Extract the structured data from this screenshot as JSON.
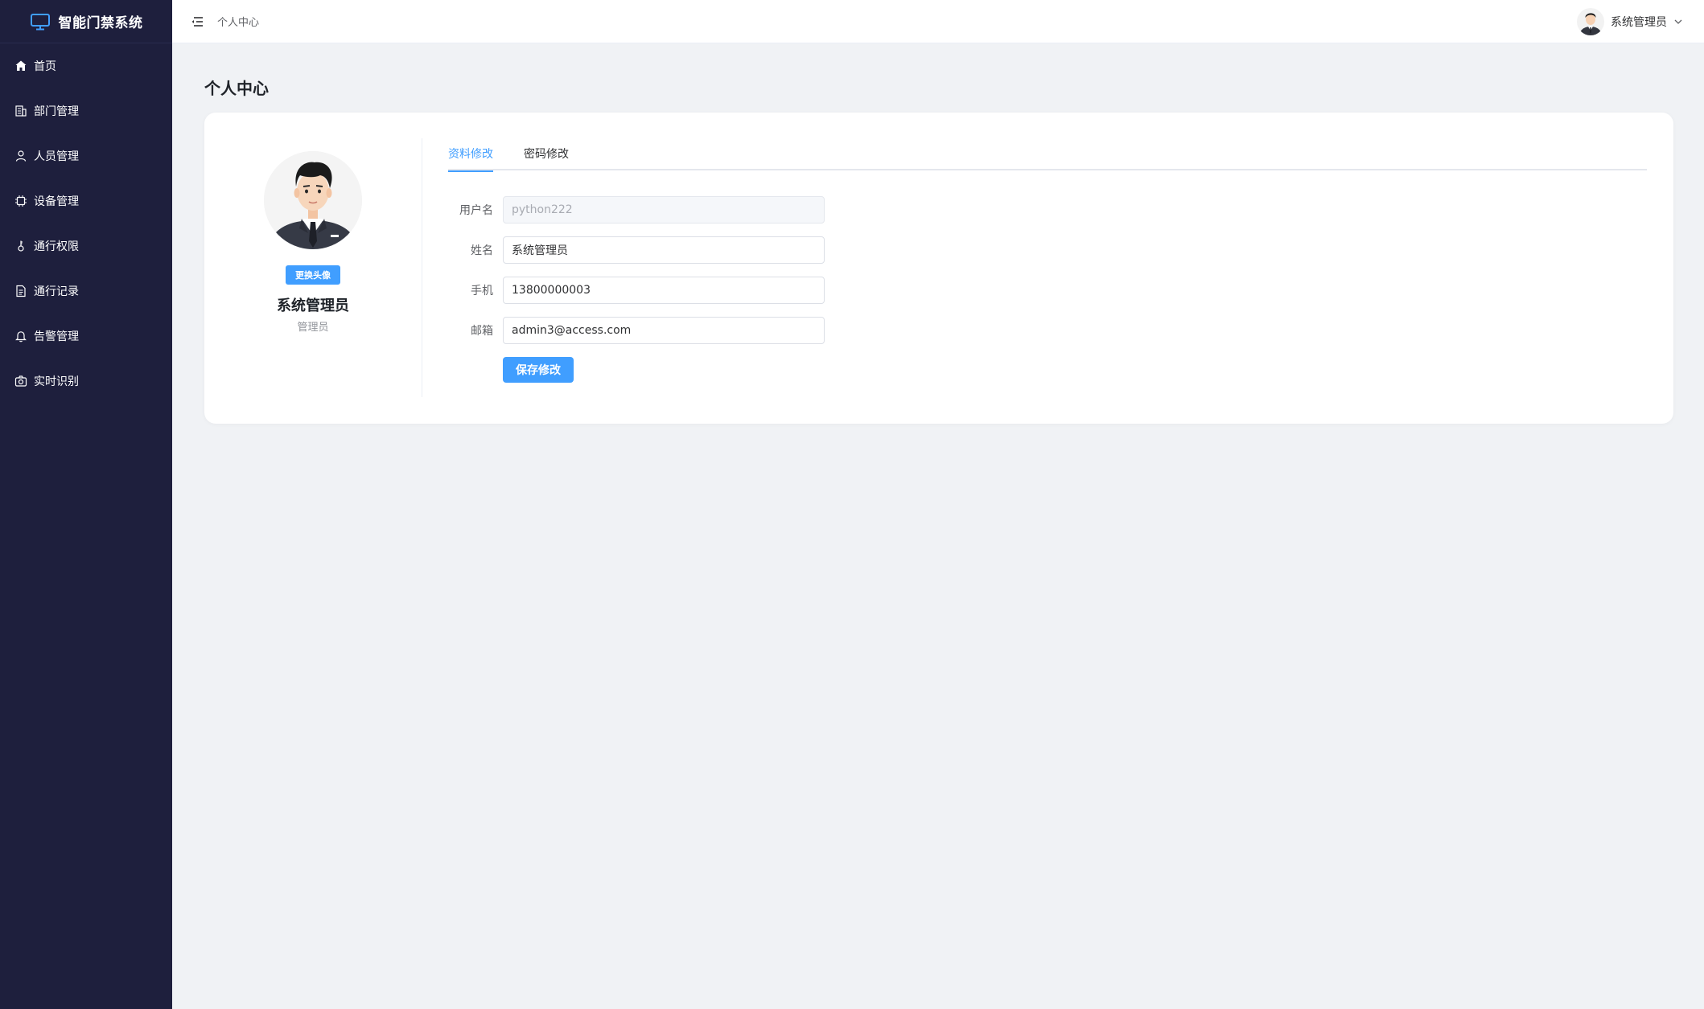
{
  "app": {
    "title": "智能门禁系统"
  },
  "sidebar": {
    "items": [
      {
        "label": "首页",
        "icon": "home-icon"
      },
      {
        "label": "部门管理",
        "icon": "building-icon"
      },
      {
        "label": "人员管理",
        "icon": "user-icon"
      },
      {
        "label": "设备管理",
        "icon": "chip-icon"
      },
      {
        "label": "通行权限",
        "icon": "key-icon"
      },
      {
        "label": "通行记录",
        "icon": "document-icon"
      },
      {
        "label": "告警管理",
        "icon": "bell-icon"
      },
      {
        "label": "实时识别",
        "icon": "camera-icon"
      }
    ]
  },
  "header": {
    "breadcrumb": "个人中心",
    "user_name": "系统管理员"
  },
  "page": {
    "title": "个人中心"
  },
  "profile": {
    "change_avatar_label": "更换头像",
    "name": "系统管理员",
    "role": "管理员"
  },
  "tabs": [
    {
      "label": "资料修改",
      "active": true
    },
    {
      "label": "密码修改",
      "active": false
    }
  ],
  "form": {
    "username_label": "用户名",
    "username_value": "python222",
    "name_label": "姓名",
    "name_value": "系统管理员",
    "phone_label": "手机",
    "phone_value": "13800000003",
    "email_label": "邮箱",
    "email_value": "admin3@access.com",
    "save_label": "保存修改"
  },
  "colors": {
    "sidebar_bg": "#1e1f3d",
    "accent": "#409eff",
    "page_bg": "#f0f2f5"
  }
}
